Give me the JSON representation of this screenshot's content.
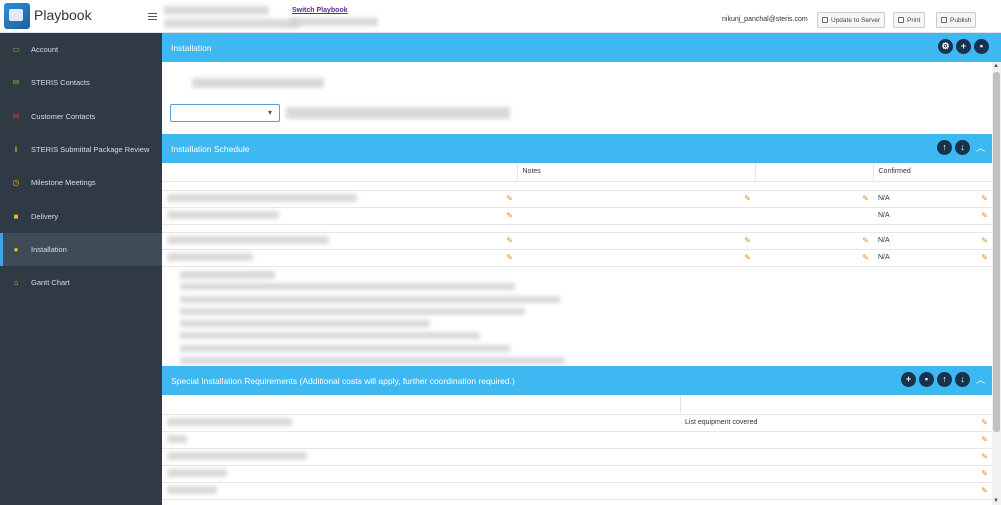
{
  "app": {
    "name": "Playbook"
  },
  "header": {
    "switch_label": "Switch Playbook",
    "user_email": "nikunj_panchal@steris.com",
    "buttons": {
      "update": "Update to Server",
      "print": "Print",
      "publish": "Publish"
    }
  },
  "sidebar": {
    "items": [
      {
        "label": "Account",
        "icon": "monitor-icon",
        "color": "#8bc34a"
      },
      {
        "label": "STERIS Contacts",
        "icon": "envelope-icon",
        "color": "#6ab04c"
      },
      {
        "label": "Customer Contacts",
        "icon": "envelope-icon",
        "color": "#e53935"
      },
      {
        "label": "STERIS Submittal Package Review",
        "icon": "info-icon",
        "color": "#f1c40f"
      },
      {
        "label": "Milestone Meetings",
        "icon": "clock-icon",
        "color": "#f5a623"
      },
      {
        "label": "Delivery",
        "icon": "lock-icon",
        "color": "#f1c40f"
      },
      {
        "label": "Installation",
        "icon": "lightbulb-icon",
        "color": "#f1c40f"
      },
      {
        "label": "Gantt Chart",
        "icon": "home-icon",
        "color": "#f5a623"
      }
    ],
    "active_index": 6
  },
  "installation": {
    "title": "Installation"
  },
  "schedule": {
    "title": "Installation Schedule",
    "columns": {
      "notes": "Notes",
      "confirmed": "Confirmed"
    },
    "rows": [
      {
        "confirmed": "N/A"
      },
      {
        "confirmed": "N/A"
      },
      {
        "confirmed": "N/A"
      },
      {
        "confirmed": "N/A"
      }
    ]
  },
  "special": {
    "title": "Special Installation Requirements (Additional costs will apply, further coordination required.)",
    "rows": [
      {
        "value": "List equipment covered"
      },
      {
        "value": ""
      },
      {
        "value": ""
      },
      {
        "value": ""
      },
      {
        "value": ""
      }
    ]
  },
  "colors": {
    "header_blue": "#3db8f0",
    "sidebar_bg": "#2f3a45",
    "icon_dark": "#17324d",
    "pencil": "#e08a1e"
  }
}
